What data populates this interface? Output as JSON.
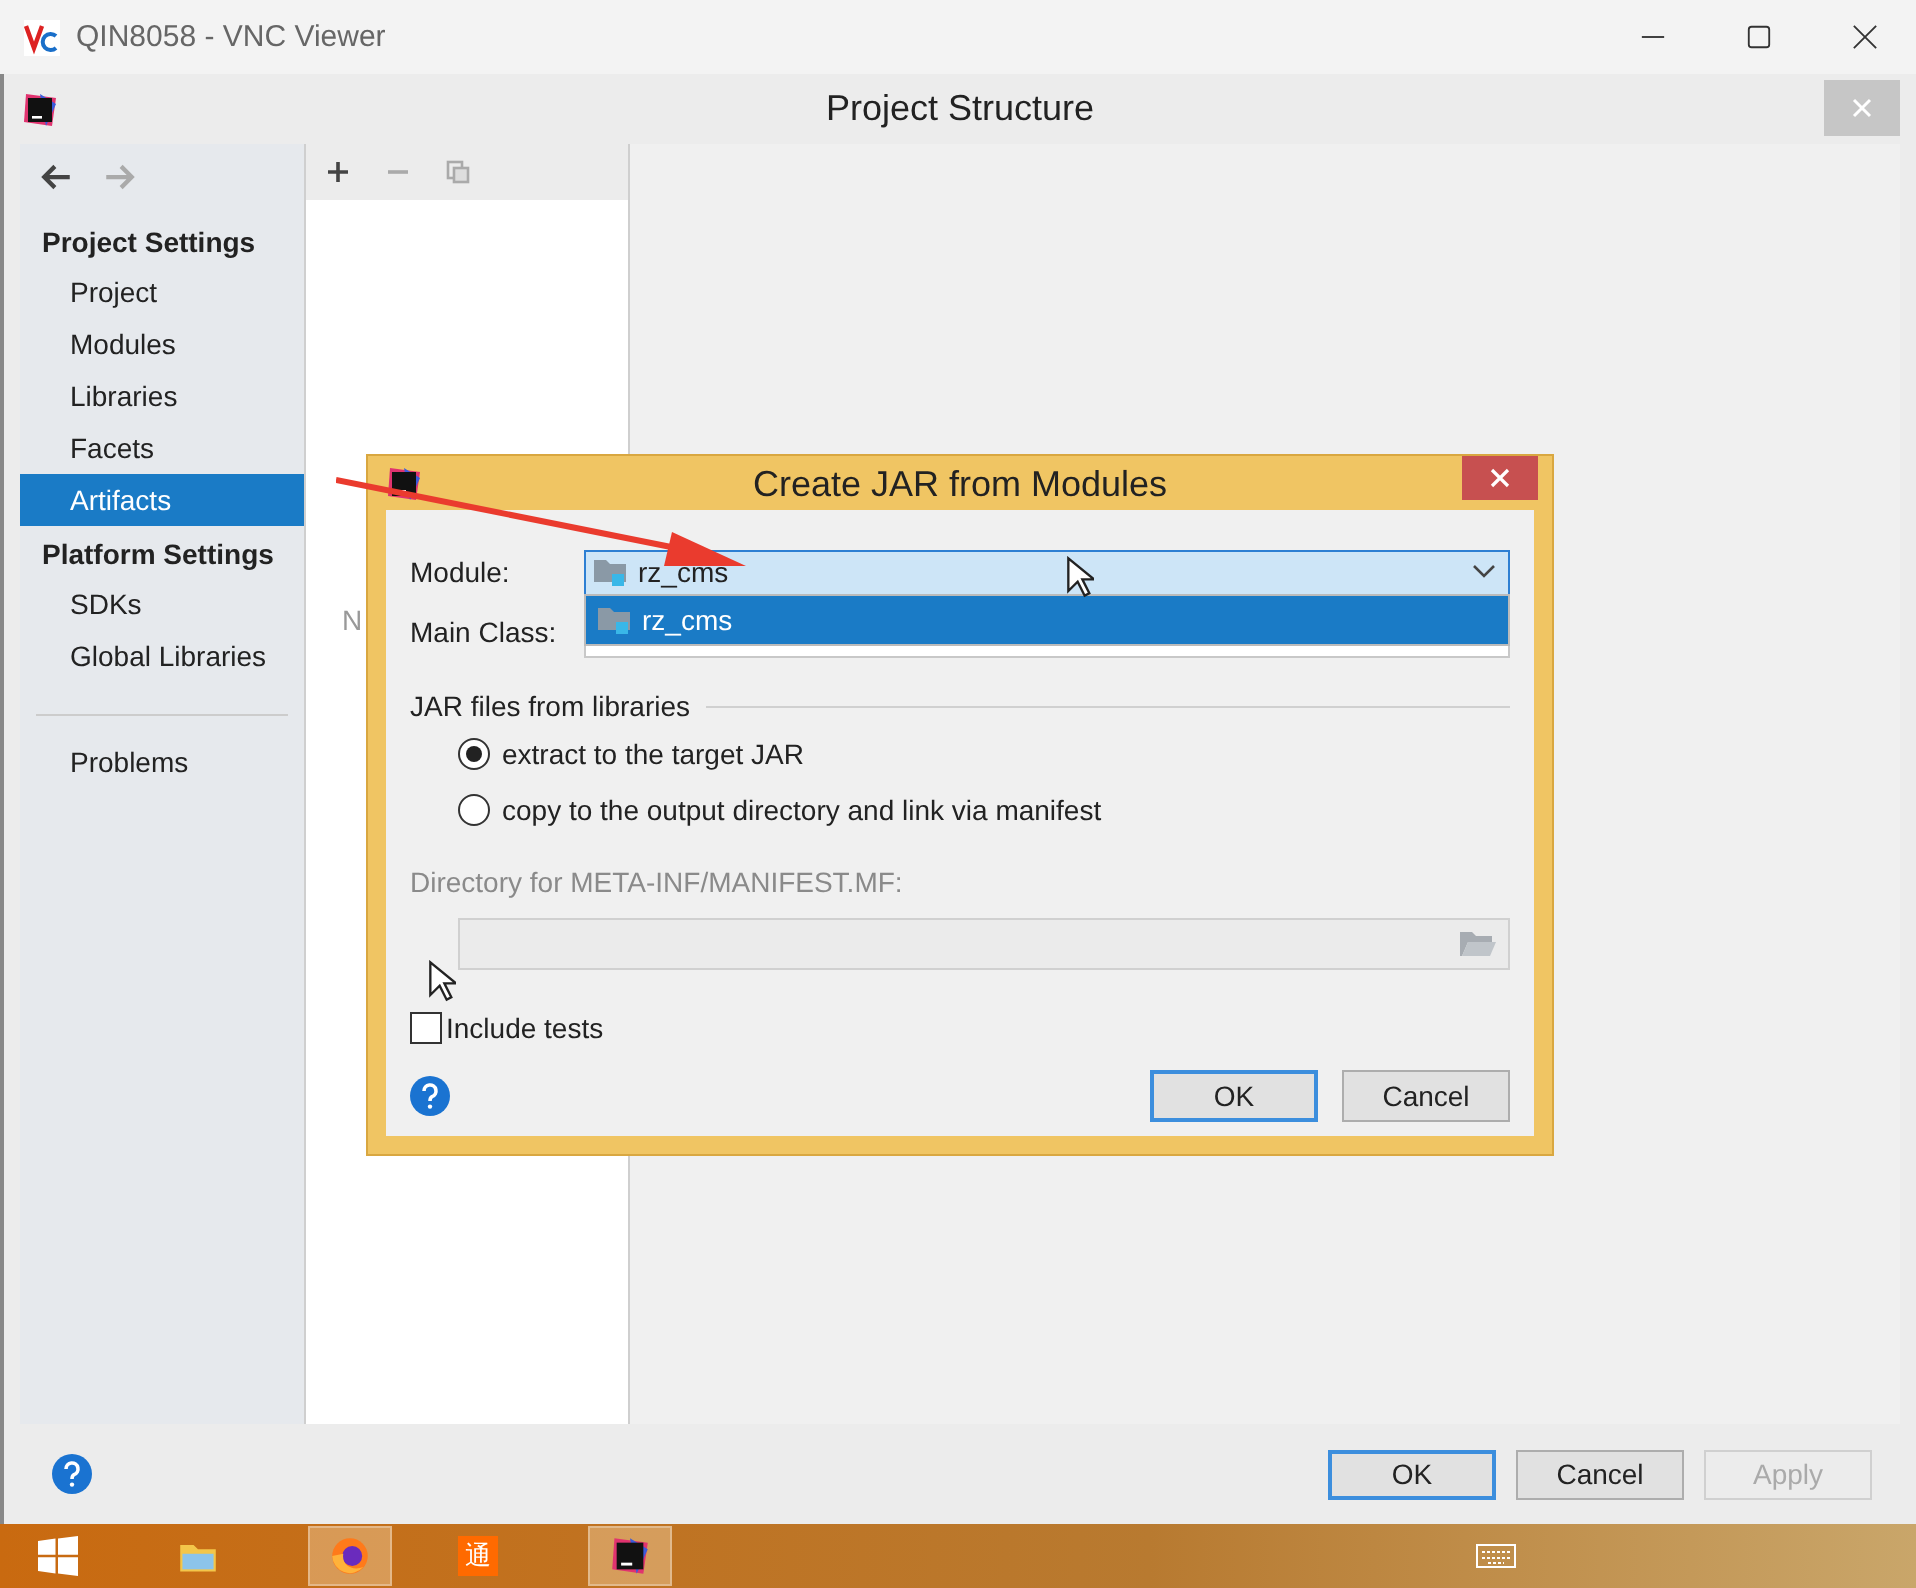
{
  "vnc_window": {
    "title": "QIN8058 - VNC Viewer"
  },
  "project_structure": {
    "title": "Project Structure",
    "sidebar": {
      "sections": [
        {
          "heading": "Project Settings",
          "items": [
            {
              "label": "Project",
              "selected": false
            },
            {
              "label": "Modules",
              "selected": false
            },
            {
              "label": "Libraries",
              "selected": false
            },
            {
              "label": "Facets",
              "selected": false
            },
            {
              "label": "Artifacts",
              "selected": true
            }
          ]
        },
        {
          "heading": "Platform Settings",
          "items": [
            {
              "label": "SDKs",
              "selected": false
            },
            {
              "label": "Global Libraries",
              "selected": false
            }
          ]
        }
      ],
      "footer_items": [
        {
          "label": "Problems",
          "selected": false
        }
      ]
    },
    "middle_list_text": "N",
    "buttons": [
      {
        "label": "OK",
        "default": true,
        "disabled": false
      },
      {
        "label": "Cancel",
        "default": false,
        "disabled": false
      },
      {
        "label": "Apply",
        "default": false,
        "disabled": true
      }
    ]
  },
  "dialog": {
    "title": "Create JAR from Modules",
    "module_label": "Module:",
    "module_value": "rz_cms",
    "dropdown_options": [
      {
        "label": "rz_cms",
        "selected": true
      }
    ],
    "main_class_label": "Main Class:",
    "group_label": "JAR files from libraries",
    "options": [
      {
        "label": "extract to the target JAR",
        "selected": true
      },
      {
        "label": "copy to the output directory and link via manifest",
        "selected": false
      }
    ],
    "directory_label": "Directory for META-INF/MANIFEST.MF:",
    "directory_disabled": true,
    "include_tests": {
      "label": "Include tests",
      "checked": false
    },
    "buttons": [
      {
        "label": "OK",
        "default": true
      },
      {
        "label": "Cancel",
        "default": false
      }
    ]
  },
  "taskbar": {
    "items": [
      {
        "kind": "start",
        "active": false
      },
      {
        "kind": "explorer",
        "active": false
      },
      {
        "kind": "firefox",
        "active": true
      },
      {
        "kind": "glyph",
        "glyph": "通",
        "active": false
      },
      {
        "kind": "intellij",
        "active": true
      }
    ]
  }
}
